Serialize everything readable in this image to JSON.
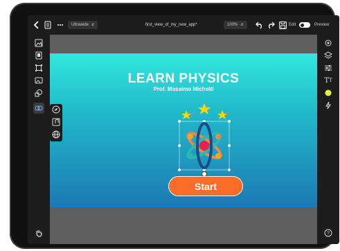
{
  "topbar": {
    "back_icon": "chevron-left-icon",
    "doc_icon": "document-icon",
    "more_icon": "more-dots-icon",
    "device_label": "Ultrawide",
    "file_name": "first_view_of_my_new_app*",
    "zoom_label": "100%",
    "undo_icon": "undo-icon",
    "redo_icon": "redo-icon",
    "save_icon": "save-icon",
    "edit_label": "Edit",
    "preview_label": "Preview"
  },
  "left_tools": [
    {
      "icon": "image-icon"
    },
    {
      "icon": "device-icon"
    },
    {
      "icon": "frame-icon"
    },
    {
      "icon": "gallery-icon"
    },
    {
      "icon": "shapes-icon"
    },
    {
      "icon": "link-icon"
    }
  ],
  "flyout_tools": [
    {
      "icon": "compass-icon"
    },
    {
      "icon": "music-icon"
    },
    {
      "icon": "globe-icon"
    }
  ],
  "right_tools": [
    {
      "icon": "settings-icon"
    },
    {
      "icon": "layers-icon"
    },
    {
      "icon": "sliders-icon"
    },
    {
      "icon": "text-icon"
    },
    {
      "icon": "color-dot-icon"
    },
    {
      "icon": "bolt-icon"
    }
  ],
  "canvas": {
    "title": "LEARN PHYSICS",
    "subtitle": "Prof. Massimo Michetti",
    "start_label": "Start",
    "bg_top": "#30e8dd",
    "bg_bottom": "#1c79b4",
    "button_color": "#fb6c28"
  },
  "bottom": {
    "hand_icon": "hand-icon",
    "help_icon": "help-icon"
  }
}
